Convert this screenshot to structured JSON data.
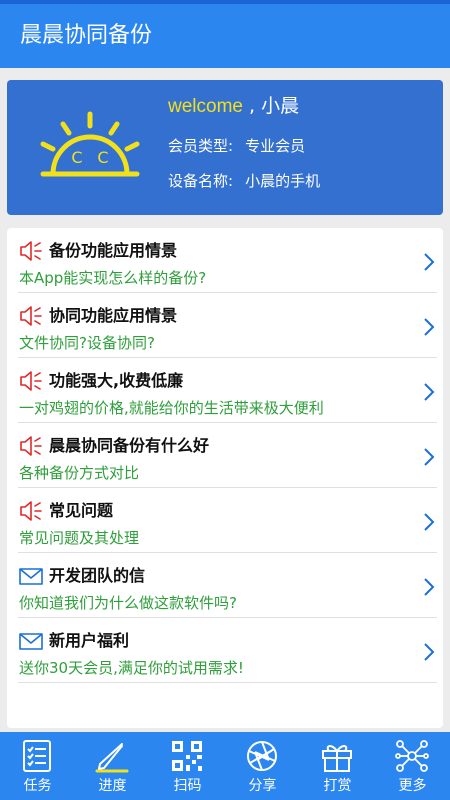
{
  "app": {
    "title": "晨晨协同备份"
  },
  "profile": {
    "welcome_en": "welcome",
    "welcome_sep": " , ",
    "user_name": "小晨",
    "member_type_label": "会员类型:",
    "member_type_value": "专业会员",
    "device_name_label": "设备名称:",
    "device_name_value": "小晨的手机",
    "logo_letters": [
      "C",
      "C"
    ]
  },
  "list": {
    "items": [
      {
        "icon": "speaker-icon",
        "title": "备份功能应用情景",
        "subtitle": "本App能实现怎么样的备份?"
      },
      {
        "icon": "speaker-icon",
        "title": "协同功能应用情景",
        "subtitle": "文件协同?设备协同?"
      },
      {
        "icon": "speaker-icon",
        "title": "功能强大,收费低廉",
        "subtitle": "一对鸡翅的价格,就能给你的生活带来极大便利"
      },
      {
        "icon": "speaker-icon",
        "title": "晨晨协同备份有什么好",
        "subtitle": "各种备份方式对比"
      },
      {
        "icon": "speaker-icon",
        "title": "常见问题",
        "subtitle": "常见问题及其处理"
      },
      {
        "icon": "envelope-icon",
        "title": "开发团队的信",
        "subtitle": "你知道我们为什么做这款软件吗?"
      },
      {
        "icon": "envelope-icon",
        "title": "新用户福利",
        "subtitle": "送你30天会员,满足你的试用需求!"
      }
    ]
  },
  "bottom_nav": {
    "tabs": [
      {
        "icon": "task-list-icon",
        "label": "任务"
      },
      {
        "icon": "progress-pen-icon",
        "label": "进度"
      },
      {
        "icon": "qr-code-icon",
        "label": "扫码"
      },
      {
        "icon": "share-aperture-icon",
        "label": "分享"
      },
      {
        "icon": "gift-icon",
        "label": "打赏"
      },
      {
        "icon": "network-icon",
        "label": "更多"
      }
    ]
  },
  "colors": {
    "app_bar": "#2b86f0",
    "profile_card": "#3470d0",
    "logo_yellow": "#f2e01a",
    "speaker_red": "#e02a2a",
    "envelope_blue": "#1a6fd8",
    "subtitle_green": "#2e9f3a"
  }
}
